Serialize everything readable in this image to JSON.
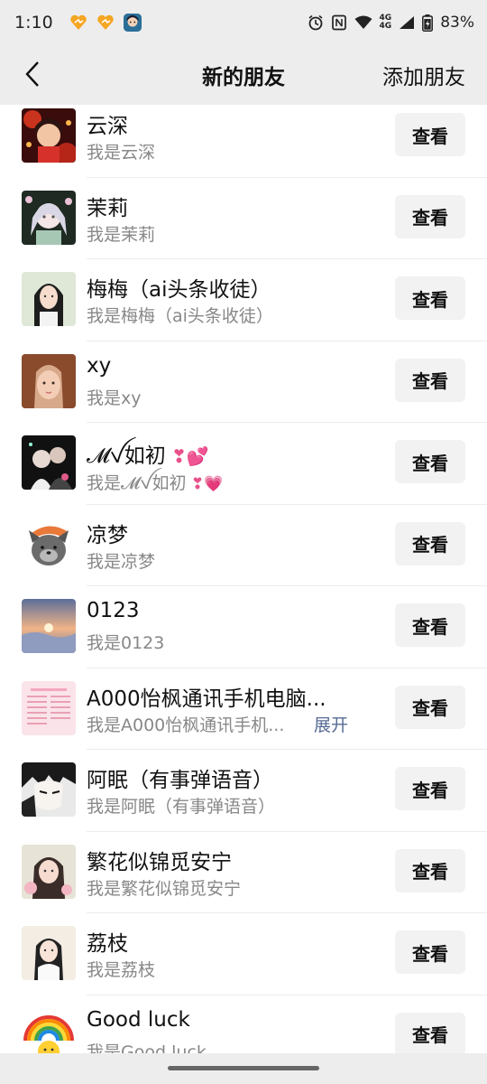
{
  "status_bar": {
    "time": "1:10",
    "network": "4G",
    "network2": "4G",
    "battery": "83%"
  },
  "nav": {
    "title": "新的朋友",
    "add_label": "添加朋友"
  },
  "colors": {
    "header_bg": "#ededed",
    "link": "#576b95",
    "button_bg": "#f2f2f2"
  },
  "friends": [
    {
      "name": "云深",
      "sub": "我是云深",
      "button": "查看",
      "avatar_icon": "avatar-red-girl"
    },
    {
      "name": "茉莉",
      "sub": "我是茉莉",
      "button": "查看",
      "avatar_icon": "avatar-anime-girl"
    },
    {
      "name": "梅梅（ai头条收徒）",
      "sub": "我是梅梅（ai头条收徒）",
      "button": "查看",
      "avatar_icon": "avatar-photo-girl"
    },
    {
      "name": "xy",
      "sub": "我是xy",
      "button": "查看",
      "avatar_icon": "avatar-selfie"
    },
    {
      "name": "𝓜ꪜ如初",
      "sub": "我是𝓜ꪜ如初",
      "button": "查看",
      "avatar_icon": "avatar-dark"
    },
    {
      "name": "凉梦",
      "sub": "我是凉梦",
      "button": "查看",
      "avatar_icon": "avatar-wolf-cartoon"
    },
    {
      "name": "0123",
      "sub": "我是0123",
      "button": "查看",
      "avatar_icon": "avatar-sunset"
    },
    {
      "name": "A000怡枫通讯手机电脑...",
      "sub": "我是A000怡枫通讯手机...",
      "expand": "展开",
      "button": "查看",
      "avatar_icon": "avatar-pink-list"
    },
    {
      "name": "阿眠（有事弹语音）",
      "sub": "我是阿眠（有事弹语音）",
      "button": "查看",
      "avatar_icon": "avatar-manga-boy"
    },
    {
      "name": "繁花似锦觅安宁",
      "sub": "我是繁花似锦觅安宁",
      "button": "查看",
      "avatar_icon": "avatar-flower-girl"
    },
    {
      "name": "荔枝",
      "sub": "我是荔枝",
      "button": "查看",
      "avatar_icon": "avatar-litchi-girl"
    },
    {
      "name": "Good luck",
      "sub": "我是Good luck",
      "button": "查看",
      "avatar_icon": "avatar-rainbow"
    }
  ]
}
